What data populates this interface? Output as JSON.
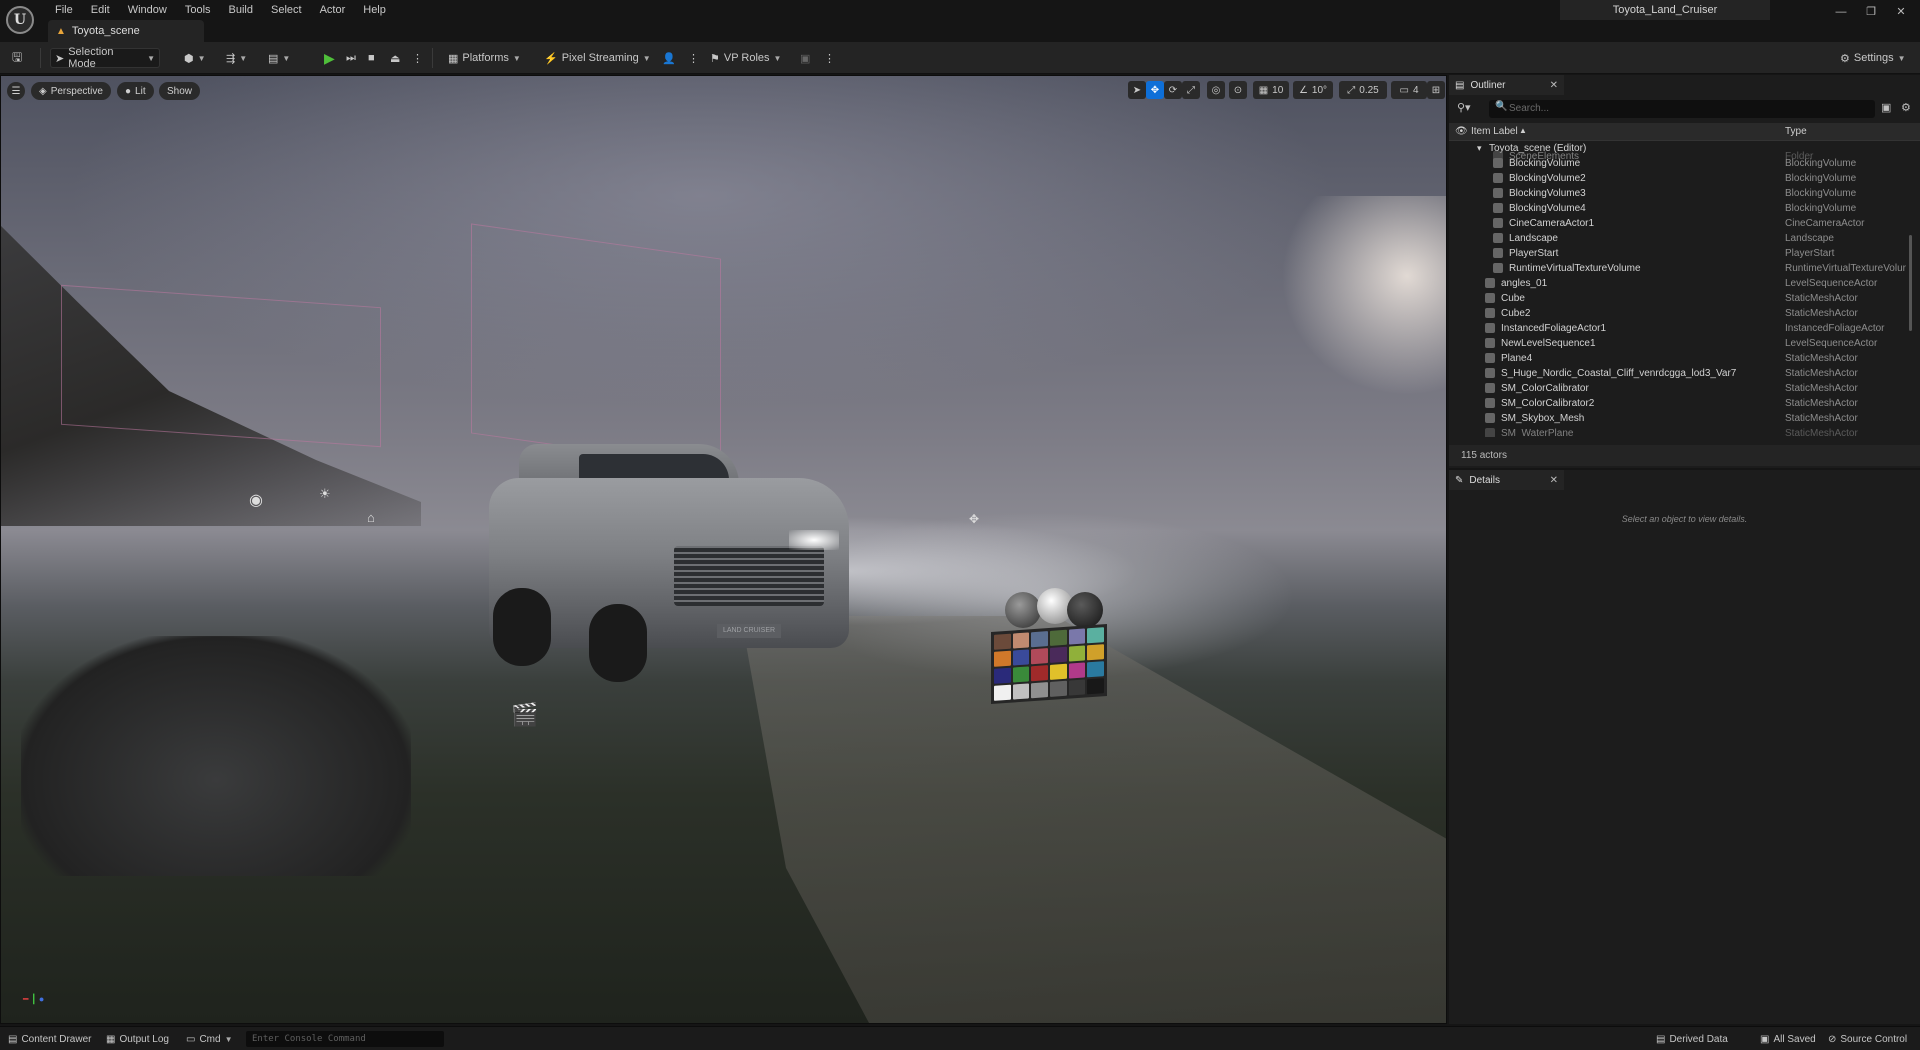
{
  "app": {
    "logo_letter": "U",
    "menu": [
      "File",
      "Edit",
      "Window",
      "Tools",
      "Build",
      "Select",
      "Actor",
      "Help"
    ],
    "document_tab": "Toyota_scene",
    "project_name": "Toyota_Land_Cruiser"
  },
  "toolbar": {
    "selection_mode": "Selection Mode",
    "platforms": "Platforms",
    "pixel_streaming": "Pixel Streaming",
    "vp_roles": "VP Roles",
    "settings": "Settings"
  },
  "viewport": {
    "perspective": "Perspective",
    "lit": "Lit",
    "show": "Show",
    "grid_snap": "10",
    "rotation_snap": "10°",
    "scale_snap": "0.25",
    "camera_speed": "4",
    "car_plate": "LAND CRUISER"
  },
  "outliner": {
    "tab_title": "Outliner",
    "search_placeholder": "Search...",
    "col_label": "Item Label",
    "col_type": "Type",
    "root": "Toyota_scene (Editor)",
    "partial_top": {
      "label": "SceneElements",
      "type": "Folder"
    },
    "rows": [
      {
        "label": "BlockingVolume",
        "type": "BlockingVolume",
        "indent": 2
      },
      {
        "label": "BlockingVolume2",
        "type": "BlockingVolume",
        "indent": 2
      },
      {
        "label": "BlockingVolume3",
        "type": "BlockingVolume",
        "indent": 2
      },
      {
        "label": "BlockingVolume4",
        "type": "BlockingVolume",
        "indent": 2
      },
      {
        "label": "CineCameraActor1",
        "type": "CineCameraActor",
        "indent": 2
      },
      {
        "label": "Landscape",
        "type": "Landscape",
        "indent": 2
      },
      {
        "label": "PlayerStart",
        "type": "PlayerStart",
        "indent": 2
      },
      {
        "label": "RuntimeVirtualTextureVolume",
        "type": "RuntimeVirtualTextureVolur",
        "indent": 2
      },
      {
        "label": "angles_01",
        "type": "LevelSequenceActor",
        "indent": 1
      },
      {
        "label": "Cube",
        "type": "StaticMeshActor",
        "indent": 1
      },
      {
        "label": "Cube2",
        "type": "StaticMeshActor",
        "indent": 1
      },
      {
        "label": "InstancedFoliageActor1",
        "type": "InstancedFoliageActor",
        "indent": 1
      },
      {
        "label": "NewLevelSequence1",
        "type": "LevelSequenceActor",
        "indent": 1
      },
      {
        "label": "Plane4",
        "type": "StaticMeshActor",
        "indent": 1
      },
      {
        "label": "S_Huge_Nordic_Coastal_Cliff_venrdcgga_lod3_Var7",
        "type": "StaticMeshActor",
        "indent": 1
      },
      {
        "label": "SM_ColorCalibrator",
        "type": "StaticMeshActor",
        "indent": 1
      },
      {
        "label": "SM_ColorCalibrator2",
        "type": "StaticMeshActor",
        "indent": 1
      },
      {
        "label": "SM_Skybox_Mesh",
        "type": "StaticMeshActor",
        "indent": 1
      }
    ],
    "partial_bottom": {
      "label": "SM_WaterPlane",
      "type": "StaticMeshActor"
    },
    "actor_count": "115 actors"
  },
  "details": {
    "tab_title": "Details",
    "empty_message": "Select an object to view details."
  },
  "statusbar": {
    "content_drawer": "Content Drawer",
    "output_log": "Output Log",
    "cmd": "Cmd",
    "console_placeholder": "Enter Console Command",
    "derived_data": "Derived Data",
    "all_saved": "All Saved",
    "source_control": "Source Control"
  },
  "colors": {
    "accent_blue": "#0e6fd8",
    "play_green": "#4fbf3a",
    "panel_bg": "#1c1c1c",
    "toolbar_bg": "#242424"
  },
  "icons": [
    "save-icon",
    "play-icon",
    "step-icon",
    "stop-icon",
    "eject-icon",
    "settings-gear-icon",
    "search-icon",
    "eye-icon",
    "filter-icon",
    "select-arrow-icon",
    "translate-icon",
    "rotate-icon",
    "scale-icon",
    "grid-icon",
    "angle-icon",
    "camera-icon",
    "maximize-icon"
  ]
}
